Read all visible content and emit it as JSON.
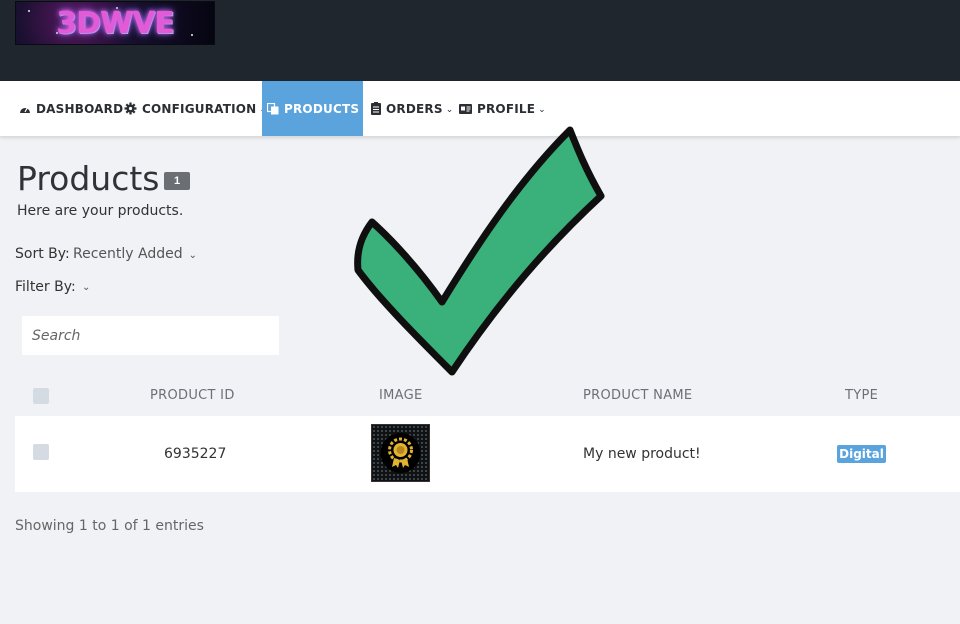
{
  "logo": {
    "text": "3DWVE"
  },
  "nav": {
    "items": [
      {
        "label": "DASHBOARD",
        "icon": "dashboard-icon"
      },
      {
        "label": "CONFIGURATION",
        "icon": "gear-icon"
      },
      {
        "label": "PRODUCTS",
        "icon": "products-icon",
        "active": true
      },
      {
        "label": "ORDERS",
        "icon": "orders-icon"
      },
      {
        "label": "PROFILE",
        "icon": "profile-card-icon"
      }
    ]
  },
  "page": {
    "title": "Products",
    "count": "1",
    "subtitle": "Here are your products."
  },
  "sort": {
    "label": "Sort By:",
    "value": "Recently Added"
  },
  "filter": {
    "label": "Filter By:"
  },
  "search": {
    "placeholder": "Search"
  },
  "table": {
    "headers": [
      "PRODUCT ID",
      "IMAGE",
      "PRODUCT NAME",
      "TYPE"
    ],
    "rows": [
      {
        "id": "6935227",
        "image": "award-badge-thumbnail",
        "name": "My new product!",
        "type": "Digital"
      }
    ]
  },
  "footer": {
    "entries": "Showing 1 to 1 of 1 entries"
  },
  "colors": {
    "accent": "#5aa3dc",
    "topbar": "#1f262d",
    "checkmark": "#3ab07b"
  }
}
